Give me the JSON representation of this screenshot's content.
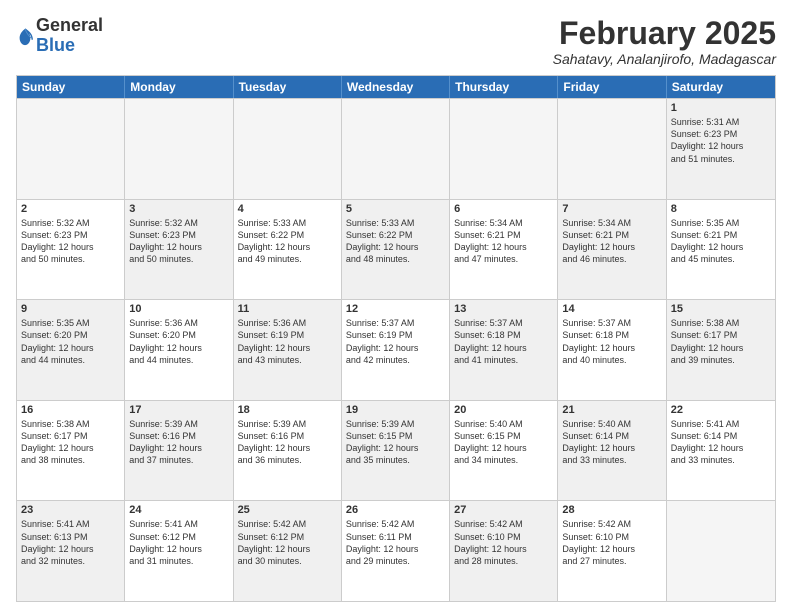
{
  "header": {
    "logo": {
      "general": "General",
      "blue": "Blue"
    },
    "title": "February 2025",
    "location": "Sahatavy, Analanjirofo, Madagascar"
  },
  "weekdays": [
    "Sunday",
    "Monday",
    "Tuesday",
    "Wednesday",
    "Thursday",
    "Friday",
    "Saturday"
  ],
  "rows": [
    [
      {
        "day": "",
        "info": "",
        "empty": true
      },
      {
        "day": "",
        "info": "",
        "empty": true
      },
      {
        "day": "",
        "info": "",
        "empty": true
      },
      {
        "day": "",
        "info": "",
        "empty": true
      },
      {
        "day": "",
        "info": "",
        "empty": true
      },
      {
        "day": "",
        "info": "",
        "empty": true
      },
      {
        "day": "1",
        "info": "Sunrise: 5:31 AM\nSunset: 6:23 PM\nDaylight: 12 hours\nand 51 minutes.",
        "shaded": true
      }
    ],
    [
      {
        "day": "2",
        "info": "Sunrise: 5:32 AM\nSunset: 6:23 PM\nDaylight: 12 hours\nand 50 minutes."
      },
      {
        "day": "3",
        "info": "Sunrise: 5:32 AM\nSunset: 6:23 PM\nDaylight: 12 hours\nand 50 minutes.",
        "shaded": true
      },
      {
        "day": "4",
        "info": "Sunrise: 5:33 AM\nSunset: 6:22 PM\nDaylight: 12 hours\nand 49 minutes."
      },
      {
        "day": "5",
        "info": "Sunrise: 5:33 AM\nSunset: 6:22 PM\nDaylight: 12 hours\nand 48 minutes.",
        "shaded": true
      },
      {
        "day": "6",
        "info": "Sunrise: 5:34 AM\nSunset: 6:21 PM\nDaylight: 12 hours\nand 47 minutes."
      },
      {
        "day": "7",
        "info": "Sunrise: 5:34 AM\nSunset: 6:21 PM\nDaylight: 12 hours\nand 46 minutes.",
        "shaded": true
      },
      {
        "day": "8",
        "info": "Sunrise: 5:35 AM\nSunset: 6:21 PM\nDaylight: 12 hours\nand 45 minutes."
      }
    ],
    [
      {
        "day": "9",
        "info": "Sunrise: 5:35 AM\nSunset: 6:20 PM\nDaylight: 12 hours\nand 44 minutes.",
        "shaded": true
      },
      {
        "day": "10",
        "info": "Sunrise: 5:36 AM\nSunset: 6:20 PM\nDaylight: 12 hours\nand 44 minutes."
      },
      {
        "day": "11",
        "info": "Sunrise: 5:36 AM\nSunset: 6:19 PM\nDaylight: 12 hours\nand 43 minutes.",
        "shaded": true
      },
      {
        "day": "12",
        "info": "Sunrise: 5:37 AM\nSunset: 6:19 PM\nDaylight: 12 hours\nand 42 minutes."
      },
      {
        "day": "13",
        "info": "Sunrise: 5:37 AM\nSunset: 6:18 PM\nDaylight: 12 hours\nand 41 minutes.",
        "shaded": true
      },
      {
        "day": "14",
        "info": "Sunrise: 5:37 AM\nSunset: 6:18 PM\nDaylight: 12 hours\nand 40 minutes."
      },
      {
        "day": "15",
        "info": "Sunrise: 5:38 AM\nSunset: 6:17 PM\nDaylight: 12 hours\nand 39 minutes.",
        "shaded": true
      }
    ],
    [
      {
        "day": "16",
        "info": "Sunrise: 5:38 AM\nSunset: 6:17 PM\nDaylight: 12 hours\nand 38 minutes."
      },
      {
        "day": "17",
        "info": "Sunrise: 5:39 AM\nSunset: 6:16 PM\nDaylight: 12 hours\nand 37 minutes.",
        "shaded": true
      },
      {
        "day": "18",
        "info": "Sunrise: 5:39 AM\nSunset: 6:16 PM\nDaylight: 12 hours\nand 36 minutes."
      },
      {
        "day": "19",
        "info": "Sunrise: 5:39 AM\nSunset: 6:15 PM\nDaylight: 12 hours\nand 35 minutes.",
        "shaded": true
      },
      {
        "day": "20",
        "info": "Sunrise: 5:40 AM\nSunset: 6:15 PM\nDaylight: 12 hours\nand 34 minutes."
      },
      {
        "day": "21",
        "info": "Sunrise: 5:40 AM\nSunset: 6:14 PM\nDaylight: 12 hours\nand 33 minutes.",
        "shaded": true
      },
      {
        "day": "22",
        "info": "Sunrise: 5:41 AM\nSunset: 6:14 PM\nDaylight: 12 hours\nand 33 minutes."
      }
    ],
    [
      {
        "day": "23",
        "info": "Sunrise: 5:41 AM\nSunset: 6:13 PM\nDaylight: 12 hours\nand 32 minutes.",
        "shaded": true
      },
      {
        "day": "24",
        "info": "Sunrise: 5:41 AM\nSunset: 6:12 PM\nDaylight: 12 hours\nand 31 minutes."
      },
      {
        "day": "25",
        "info": "Sunrise: 5:42 AM\nSunset: 6:12 PM\nDaylight: 12 hours\nand 30 minutes.",
        "shaded": true
      },
      {
        "day": "26",
        "info": "Sunrise: 5:42 AM\nSunset: 6:11 PM\nDaylight: 12 hours\nand 29 minutes."
      },
      {
        "day": "27",
        "info": "Sunrise: 5:42 AM\nSunset: 6:10 PM\nDaylight: 12 hours\nand 28 minutes.",
        "shaded": true
      },
      {
        "day": "28",
        "info": "Sunrise: 5:42 AM\nSunset: 6:10 PM\nDaylight: 12 hours\nand 27 minutes."
      },
      {
        "day": "",
        "info": "",
        "empty": true
      }
    ]
  ]
}
